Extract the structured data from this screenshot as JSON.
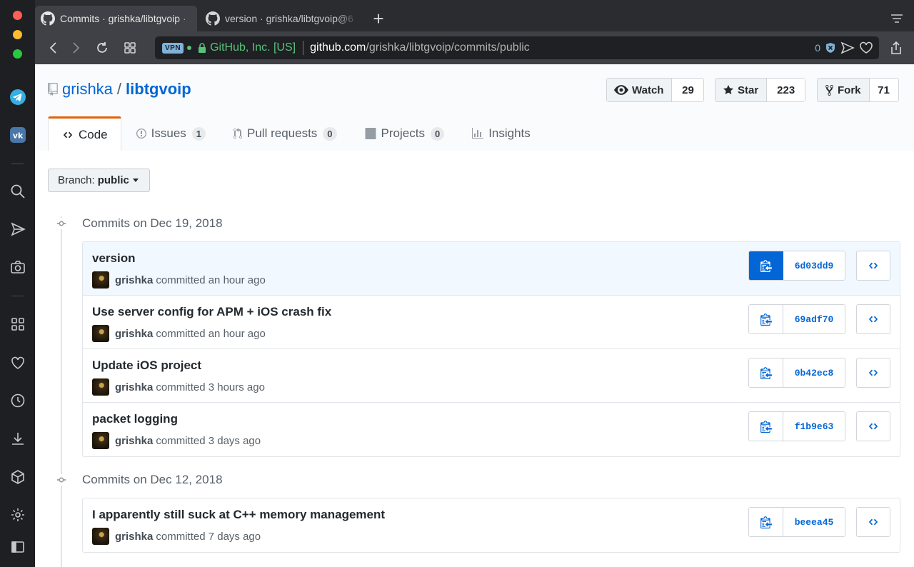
{
  "browser": {
    "tabs": [
      {
        "title": "Commits · grishka/libtgvoip · ",
        "active": true
      },
      {
        "title": "version · grishka/libtgvoip@6",
        "active": false
      }
    ],
    "new_tab_symbol": "+",
    "address": {
      "vpn_badge": "VPN",
      "cert_name": "GitHub, Inc. [US]",
      "url_host": "github.com",
      "url_path": "/grishka/libtgvoip/commits/public",
      "blocked_count": "0"
    },
    "colors": {
      "accent": "#0366d6",
      "cert": "#58c27b",
      "tab_highlight": "#e36209"
    }
  },
  "sidebar": {
    "icons": [
      "telegram-icon",
      "vk-icon",
      "search-icon",
      "send-icon",
      "camera-icon",
      "apps-icon",
      "heart-icon",
      "clock-icon",
      "download-icon",
      "cube-icon",
      "gear-icon",
      "sidebar-toggle-icon"
    ]
  },
  "repo": {
    "owner": "grishka",
    "separator": "/",
    "name": "libtgvoip",
    "watch": {
      "label": "Watch",
      "count": "29"
    },
    "star": {
      "label": "Star",
      "count": "223"
    },
    "fork": {
      "label": "Fork",
      "count": "71"
    },
    "tabs": [
      {
        "label": "Code",
        "counter": ""
      },
      {
        "label": "Issues",
        "counter": "1"
      },
      {
        "label": "Pull requests",
        "counter": "0"
      },
      {
        "label": "Projects",
        "counter": "0"
      },
      {
        "label": "Insights",
        "counter": ""
      }
    ],
    "branch": {
      "prefix": "Branch:",
      "name": "public"
    }
  },
  "commit_groups": [
    {
      "date": "Commits on Dec 19, 2018",
      "commits": [
        {
          "message": "version",
          "author": "grishka",
          "meta": "committed an hour ago",
          "sha": "6d03dd9"
        },
        {
          "message": "Use server config for APM + iOS crash fix",
          "author": "grishka",
          "meta": "committed an hour ago",
          "sha": "69adf70"
        },
        {
          "message": "Update iOS project",
          "author": "grishka",
          "meta": "committed 3 hours ago",
          "sha": "0b42ec8"
        },
        {
          "message": "packet logging",
          "author": "grishka",
          "meta": "committed 3 days ago",
          "sha": "f1b9e63"
        }
      ]
    },
    {
      "date": "Commits on Dec 12, 2018",
      "commits": [
        {
          "message": "I apparently still suck at C++ memory management",
          "author": "grishka",
          "meta": "committed 7 days ago",
          "sha": "beeea45"
        }
      ]
    }
  ]
}
